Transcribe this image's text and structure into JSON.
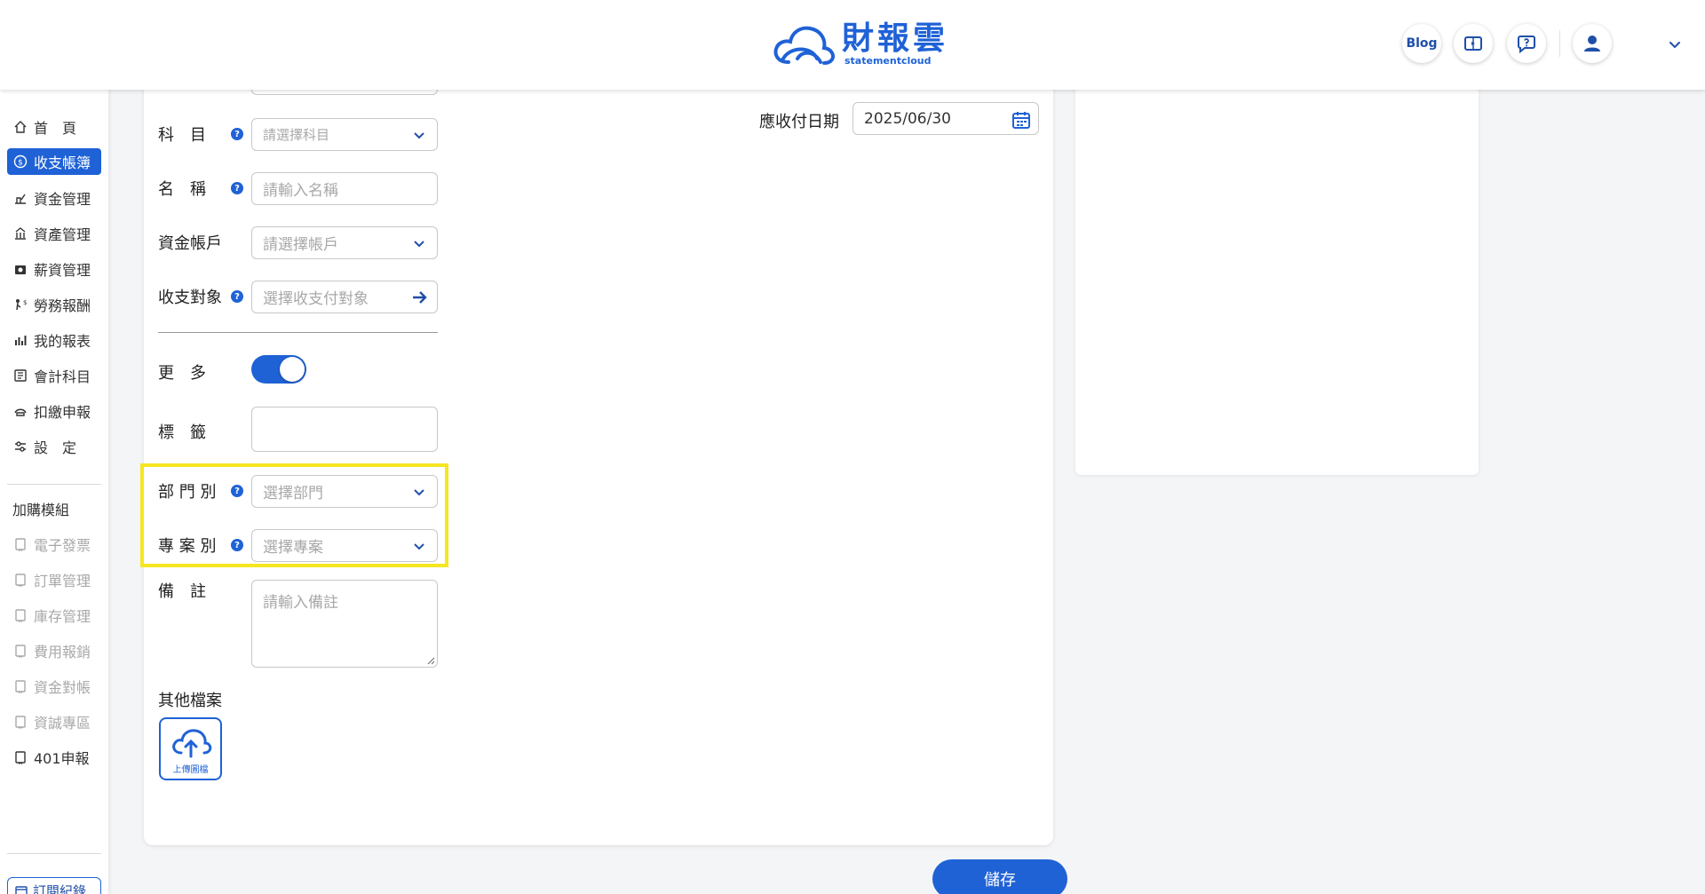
{
  "header": {
    "logo_zh": "財報雲",
    "logo_en": "statementcloud",
    "blog_label": "Blog"
  },
  "sidebar": {
    "items": [
      {
        "label": "首　頁",
        "icon": "home-icon"
      },
      {
        "label": "收支帳簿",
        "icon": "ledger-icon"
      },
      {
        "label": "資金管理",
        "icon": "funds-icon"
      },
      {
        "label": "資產管理",
        "icon": "assets-icon"
      },
      {
        "label": "薪資管理",
        "icon": "payroll-icon"
      },
      {
        "label": "勞務報酬",
        "icon": "labor-icon"
      },
      {
        "label": "我的報表",
        "icon": "report-icon"
      },
      {
        "label": "會計科目",
        "icon": "accounts-icon"
      },
      {
        "label": "扣繳申報",
        "icon": "withholding-icon"
      },
      {
        "label": "設　定",
        "icon": "settings-icon"
      }
    ],
    "addon_header": "加購模組",
    "addons": [
      {
        "label": "電子發票"
      },
      {
        "label": "訂單管理"
      },
      {
        "label": "庫存管理"
      },
      {
        "label": "費用報銷"
      },
      {
        "label": "資金對帳"
      },
      {
        "label": "資誠專區"
      },
      {
        "label": "401申報"
      }
    ],
    "bottom_label": "訂閱紀錄"
  },
  "form": {
    "subject": {
      "label": "科　目",
      "placeholder": "請選擇科目"
    },
    "name": {
      "label": "名　稱",
      "placeholder": "請輸入名稱"
    },
    "account": {
      "label": "資金帳戶",
      "placeholder": "請選擇帳戶"
    },
    "target": {
      "label": "收支對象",
      "placeholder": "選擇收支付對象"
    },
    "more": {
      "label": "更　多",
      "enabled": true
    },
    "tags": {
      "label": "標　籤"
    },
    "department": {
      "label": "部 門 別",
      "placeholder": "選擇部門"
    },
    "project": {
      "label": "專 案 別",
      "placeholder": "選擇專案"
    },
    "note": {
      "label": "備　註",
      "placeholder": "請輸入備註"
    },
    "files": {
      "label": "其他檔案",
      "upload_label": "上傳圖檔"
    },
    "due_date": {
      "label": "應收付日期",
      "value": "2025/06/30"
    },
    "help_symbol": "?"
  },
  "actions": {
    "save_label": "儲存"
  },
  "colors": {
    "accent": "#1f62d6",
    "highlight": "#f5e620"
  }
}
